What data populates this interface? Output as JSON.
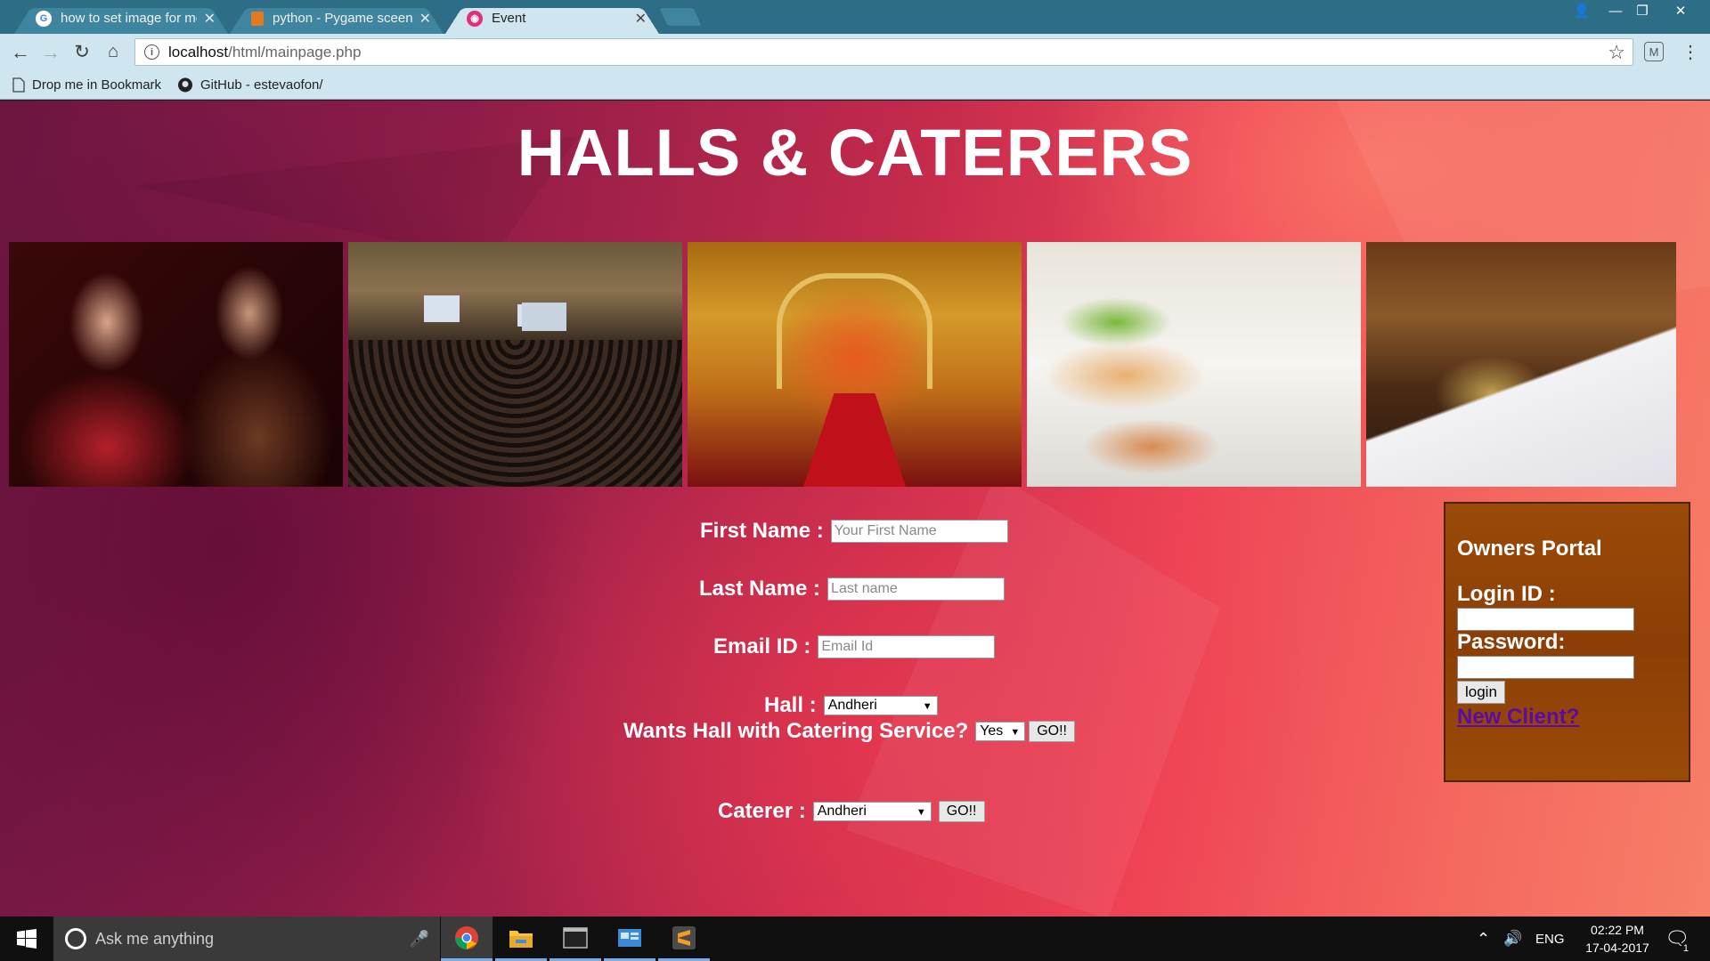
{
  "browser": {
    "tabs": [
      {
        "title": "how to set image for mo",
        "favicon": "google-icon",
        "active": false
      },
      {
        "title": "python - Pygame sceen.f",
        "favicon": "stackoverflow-icon",
        "active": false
      },
      {
        "title": "Event",
        "favicon": "site-icon",
        "active": true
      }
    ],
    "address": {
      "host": "localhost",
      "path": "/html/mainpage.php"
    },
    "bookmarks": [
      {
        "label": "Drop me in Bookmark",
        "icon": "page-icon"
      },
      {
        "label": "GitHub - estevaofon/",
        "icon": "github-icon"
      }
    ]
  },
  "page": {
    "title": "HALLS & CATERERS",
    "photos": [
      "wedding-couple",
      "conference-hall",
      "wedding-stage",
      "buffet-salads",
      "buffet-line"
    ],
    "form": {
      "first_name_label": "First Name :",
      "first_name_placeholder": "Your First Name",
      "last_name_label": "Last Name :",
      "last_name_placeholder": "Last name",
      "email_label": "Email ID :",
      "email_placeholder": "Email Id",
      "hall_label": "Hall :",
      "hall_value": "Andheri",
      "catering_label": "Wants Hall with Catering Service?",
      "catering_value": "Yes",
      "catering_go": "GO!!",
      "caterer_label": "Caterer :",
      "caterer_value": "Andheri",
      "caterer_go": "GO!!"
    },
    "owners_portal": {
      "title": "Owners Portal",
      "login_label": "Login ID :",
      "password_label": "Password:",
      "login_button": "login",
      "new_client_link": "New Client?"
    }
  },
  "taskbar": {
    "search_placeholder": "Ask me anything",
    "language": "ENG",
    "time": "02:22 PM",
    "date": "17-04-2017",
    "notification_count": "1",
    "apps": [
      "chrome-icon",
      "file-explorer-icon",
      "terminal-icon",
      "control-panel-icon",
      "sublime-text-icon"
    ]
  },
  "colors": {
    "tab_strip": "#2d6e86",
    "toolbar": "#cfe6f1",
    "portal_bg": "#9a4a08",
    "link": "#5a0aa8"
  }
}
